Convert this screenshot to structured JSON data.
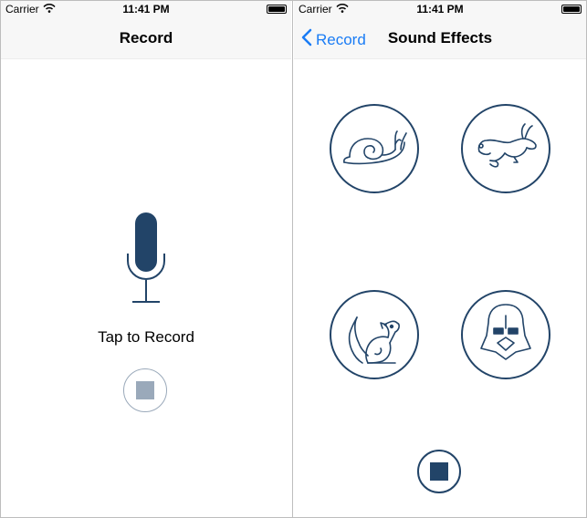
{
  "colors": {
    "primary": "#224468",
    "disabled": "#9aa9ba",
    "ios_blue": "#1a7cf5",
    "bar_background": "#f7f7f7"
  },
  "record_screen": {
    "status_bar": {
      "carrier": "Carrier",
      "time": "11:41 PM",
      "wifi_icon": "wifi-icon",
      "battery_icon": "battery-icon"
    },
    "nav_title": "Record",
    "prompt": "Tap to Record",
    "microphone_icon": "microphone-icon",
    "stop_icon": "stop-icon",
    "stop_enabled": false
  },
  "effects_screen": {
    "status_bar": {
      "carrier": "Carrier",
      "time": "11:41 PM",
      "wifi_icon": "wifi-icon",
      "battery_icon": "battery-icon"
    },
    "nav_back": "Record",
    "nav_back_icon": "chevron-left-icon",
    "nav_title": "Sound Effects",
    "effects": [
      {
        "icon": "snail-icon"
      },
      {
        "icon": "rabbit-icon"
      },
      {
        "icon": "chipmunk-icon"
      },
      {
        "icon": "darth-vader-icon"
      }
    ],
    "stop_icon": "stop-icon",
    "stop_enabled": true
  }
}
